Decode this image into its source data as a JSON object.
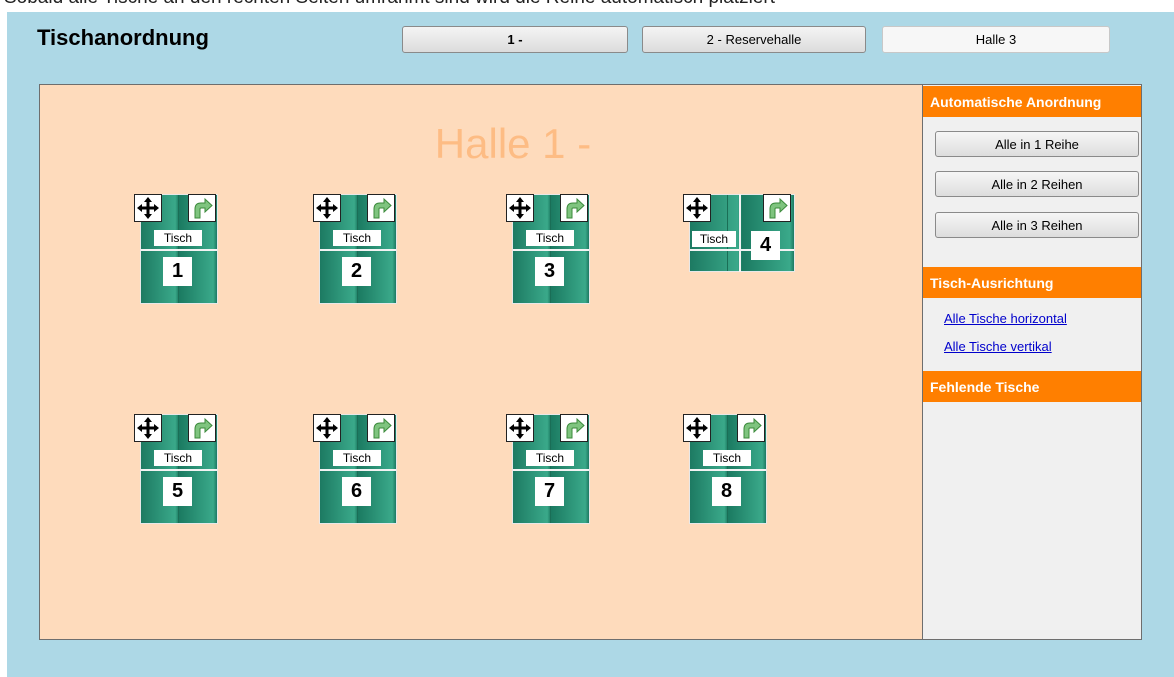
{
  "top_banner_text": "Sobald alle Tische an den rechten Seiten umrahmt sind wird die Reihe automatisch platziert",
  "window_title": "Tischanordnung",
  "hall_tabs": [
    "1 -",
    "2 - Reservehalle",
    "Halle 3"
  ],
  "hall_title": "Halle 1 -",
  "tables": [
    {
      "label": "Tisch",
      "number": "1",
      "orientation": "vertical"
    },
    {
      "label": "Tisch",
      "number": "2",
      "orientation": "vertical"
    },
    {
      "label": "Tisch",
      "number": "3",
      "orientation": "vertical"
    },
    {
      "label": "Tisch",
      "number": "4",
      "orientation": "horizontal"
    },
    {
      "label": "Tisch",
      "number": "5",
      "orientation": "vertical"
    },
    {
      "label": "Tisch",
      "number": "6",
      "orientation": "vertical"
    },
    {
      "label": "Tisch",
      "number": "7",
      "orientation": "vertical"
    },
    {
      "label": "Tisch",
      "number": "8",
      "orientation": "vertical"
    }
  ],
  "icons": {
    "move": "move-arrows-icon",
    "rotate": "rotate-arrow-icon"
  },
  "sidebar": {
    "auto_arrangement": {
      "title": "Automatische Anordnung",
      "buttons": [
        "Alle in 1 Reihe",
        "Alle in 2 Reihen",
        "Alle in 3 Reihen"
      ]
    },
    "orientation": {
      "title": "Tisch-Ausrichtung",
      "links": [
        "Alle Tische horizontal",
        "Alle Tische vertikal"
      ]
    },
    "missing": {
      "title": "Fehlende Tische"
    }
  },
  "colors": {
    "app_background": "#add8e6",
    "canvas": "#fedbbc",
    "hall_title": "#fdbc84",
    "table_green": "#2e9a7c",
    "section_header": "#ff7f00",
    "link": "#0000cc"
  }
}
